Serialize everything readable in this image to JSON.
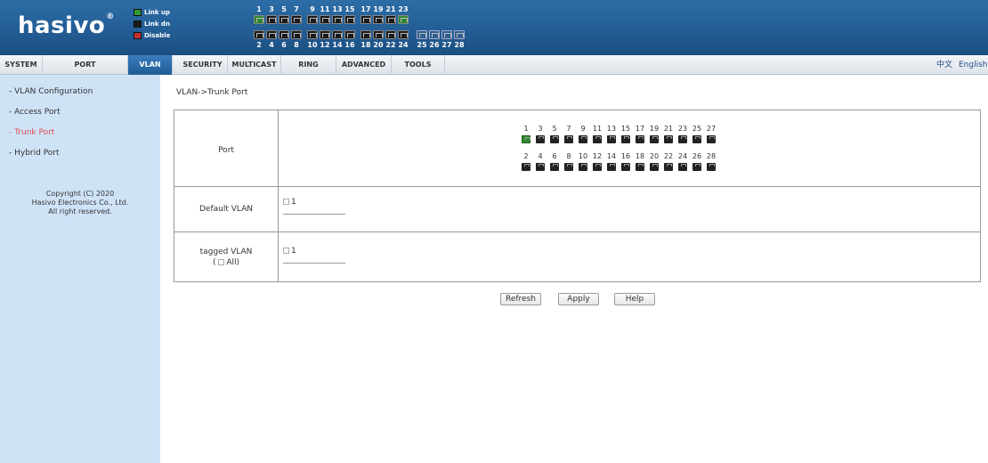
{
  "header": {
    "logo_text": "hasivo",
    "logo_mark": "®",
    "legend": [
      {
        "label": "Link up",
        "color": "#2f9a2f"
      },
      {
        "label": "Link dn",
        "color": "#1a1a1a"
      },
      {
        "label": "Disable",
        "color": "#c83030"
      }
    ],
    "ports_top": [
      "1",
      "3",
      "5",
      "7",
      "9",
      "11",
      "13",
      "15",
      "17",
      "19",
      "21",
      "23"
    ],
    "ports_bottom": [
      "2",
      "4",
      "6",
      "8",
      "10",
      "12",
      "14",
      "16",
      "18",
      "20",
      "22",
      "24"
    ],
    "sfp_ports": [
      "25",
      "26",
      "27",
      "28"
    ],
    "active_ports": [
      "1",
      "23"
    ],
    "colors": {
      "bar": "#245f97",
      "link_up": "#2f8a2f",
      "link_down": "#1a1a1a",
      "sfp": "#2e5f92"
    }
  },
  "menu": {
    "items": [
      "SYSTEM",
      "PORT",
      "VLAN",
      "SECURITY",
      "MULTICAST",
      "RING",
      "ADVANCED",
      "TOOLS"
    ],
    "active": "VLAN",
    "lang_cn": "中文",
    "lang_en": "English"
  },
  "sidebar": {
    "items": [
      "VLAN Configuration",
      "Access Port",
      "Trunk Port",
      "Hybrid Port"
    ],
    "active": "Trunk Port",
    "copyright": [
      "Copyright (C) 2020",
      "Hasivo Electronics Co., Ltd.",
      "All right reserved."
    ]
  },
  "main": {
    "breadcrumb": "VLAN->Trunk Port",
    "port_label": "Port",
    "ports_odd": [
      "1",
      "3",
      "5",
      "7",
      "9",
      "11",
      "13",
      "15",
      "17",
      "19",
      "21",
      "23",
      "25",
      "27"
    ],
    "ports_even": [
      "2",
      "4",
      "6",
      "8",
      "10",
      "12",
      "14",
      "16",
      "18",
      "20",
      "22",
      "24",
      "26",
      "28"
    ],
    "selected_ports": [
      "1"
    ],
    "default_vlan_label": "Default VLAN",
    "default_vlan_value": "1",
    "tagged_vlan_label": "tagged VLAN",
    "tagged_all_label": "All",
    "tagged_vlan_value": "1",
    "buttons": {
      "refresh": "Refresh",
      "apply": "Apply",
      "help": "Help"
    }
  }
}
